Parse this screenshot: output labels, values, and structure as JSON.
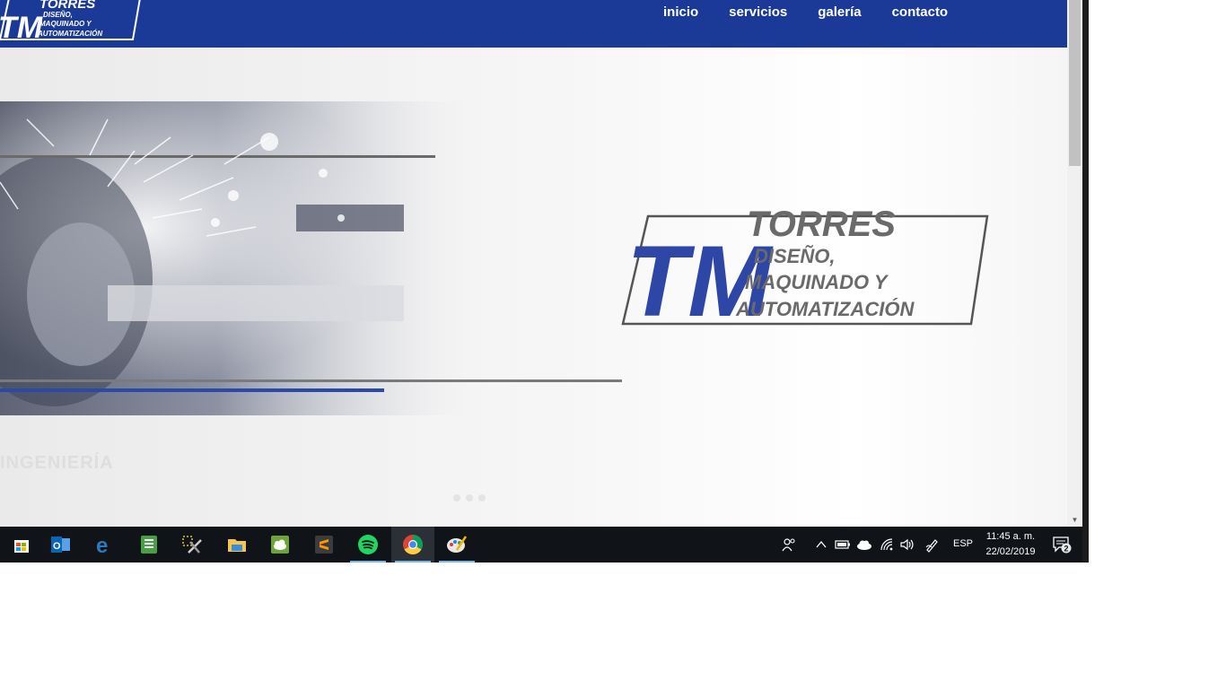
{
  "brand": {
    "initials": "TM",
    "name": "TORRES",
    "tagline_1": "DISEÑO,",
    "tagline_2": "MAQUINADO Y",
    "tagline_3": "AUTOMATIZACIÓN",
    "primary_color": "#1b3a98",
    "gray_color": "#6a6a6a"
  },
  "nav": {
    "items": [
      {
        "label": "inicio"
      },
      {
        "label": "servicios"
      },
      {
        "label": "galería"
      },
      {
        "label": "contacto"
      }
    ]
  },
  "hero": {
    "watermark_text": "INGENIERÍA",
    "slider_dots": 3
  },
  "taskbar": {
    "apps": [
      {
        "name": "microsoft-store-icon"
      },
      {
        "name": "outlook-icon"
      },
      {
        "name": "edge-icon"
      },
      {
        "name": "notes-icon"
      },
      {
        "name": "snipping-tool-icon"
      },
      {
        "name": "file-explorer-icon"
      },
      {
        "name": "cloud-app-icon"
      },
      {
        "name": "sublime-text-icon"
      },
      {
        "name": "spotify-icon"
      },
      {
        "name": "chrome-icon"
      },
      {
        "name": "paint-icon"
      }
    ],
    "language": "ESP",
    "time": "11:45 a. m.",
    "date": "22/02/2019",
    "notification_count": "2"
  }
}
